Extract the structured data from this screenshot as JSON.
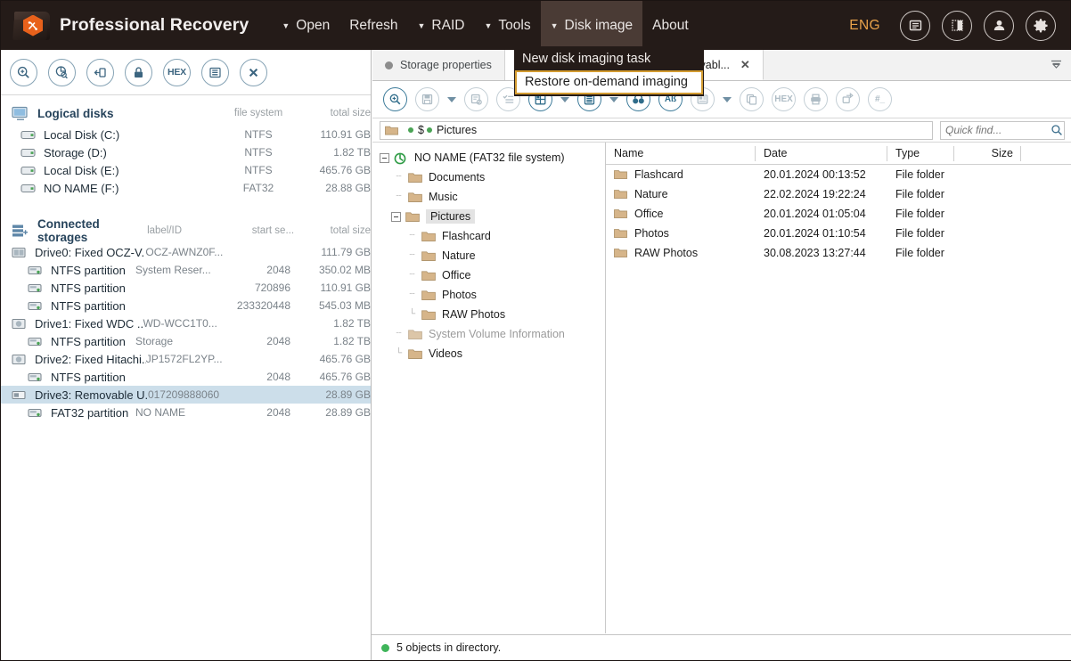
{
  "header": {
    "title": "Professional Recovery",
    "logo_icon": "app-folder-logo-icon",
    "menu": [
      {
        "label": "Open",
        "caret": "▼",
        "active": false
      },
      {
        "label": "Refresh",
        "caret": "",
        "active": false
      },
      {
        "label": "RAID",
        "caret": "▼",
        "active": false
      },
      {
        "label": "Tools",
        "caret": "▼",
        "active": false
      },
      {
        "label": "Disk image",
        "caret": "▼",
        "active": true
      },
      {
        "label": "About",
        "caret": "",
        "active": false
      }
    ],
    "language": "ENG",
    "round_buttons": [
      "notes-icon",
      "contrast-icon",
      "user-icon",
      "gear-icon"
    ]
  },
  "disk_image_menu": {
    "items": [
      {
        "label": "New disk imaging task",
        "selected": false
      },
      {
        "label": "Restore on-demand imaging",
        "selected": true
      }
    ],
    "highlight_color": "#d39b30"
  },
  "left_panel": {
    "toolbar": [
      "scan-icon",
      "partition-scan-icon",
      "open-image-icon",
      "unlock-icon",
      "hex-icon",
      "list-icon",
      "close-icon"
    ],
    "logical_disks": {
      "title": "Logical disks",
      "icon": "monitor-icon",
      "columns": [
        "file system",
        "total size"
      ],
      "rows": [
        {
          "icon": "drive-icon",
          "name": "Local Disk (C:)",
          "fs": "NTFS",
          "size": "110.91 GB"
        },
        {
          "icon": "drive-icon",
          "name": "Storage (D:)",
          "fs": "NTFS",
          "size": "1.82 TB"
        },
        {
          "icon": "drive-icon",
          "name": "Local Disk (E:)",
          "fs": "NTFS",
          "size": "465.76 GB"
        },
        {
          "icon": "drive-icon",
          "name": "NO NAME (F:)",
          "fs": "FAT32",
          "size": "28.88 GB"
        }
      ]
    },
    "connected_storages": {
      "title": "Connected storages",
      "icon": "stack-icon",
      "columns": [
        "label/ID",
        "start se...",
        "total size"
      ],
      "rows": [
        {
          "type": "storage",
          "icon": "ssd-icon",
          "name": "Drive0: Fixed OCZ-V...",
          "label": "OCZ-AWNZ0F...",
          "start": "",
          "size": "111.79 GB",
          "selected": false
        },
        {
          "type": "partition",
          "icon": "partition-icon",
          "name": "NTFS partition",
          "label": "System Reser...",
          "start": "2048",
          "size": "350.02 MB",
          "selected": false
        },
        {
          "type": "partition",
          "icon": "partition-icon",
          "name": "NTFS partition",
          "label": "",
          "start": "720896",
          "size": "110.91 GB",
          "selected": false
        },
        {
          "type": "partition",
          "icon": "partition-icon",
          "name": "NTFS partition",
          "label": "",
          "start": "233320448",
          "size": "545.03 MB",
          "selected": false
        },
        {
          "type": "storage",
          "icon": "hdd-icon",
          "name": "Drive1: Fixed WDC ...",
          "label": "WD-WCC1T0...",
          "start": "",
          "size": "1.82 TB",
          "selected": false
        },
        {
          "type": "partition",
          "icon": "partition-icon",
          "name": "NTFS partition",
          "label": "Storage",
          "start": "2048",
          "size": "1.82 TB",
          "selected": false
        },
        {
          "type": "storage",
          "icon": "hdd-icon",
          "name": "Drive2: Fixed Hitachi...",
          "label": "JP1572FL2YP...",
          "start": "",
          "size": "465.76 GB",
          "selected": false
        },
        {
          "type": "partition",
          "icon": "partition-icon",
          "name": "NTFS partition",
          "label": "",
          "start": "2048",
          "size": "465.76 GB",
          "selected": false
        },
        {
          "type": "storage",
          "icon": "usb-icon",
          "name": "Drive3: Removable U...",
          "label": "017209888060",
          "start": "",
          "size": "28.89 GB",
          "selected": true
        },
        {
          "type": "partition",
          "icon": "partition-icon",
          "name": "FAT32 partition",
          "label": "NO NAME",
          "start": "2048",
          "size": "28.89 GB",
          "selected": false
        }
      ]
    }
  },
  "right_panel": {
    "tabs": [
      {
        "label": "Storage properties",
        "active": false,
        "closable": false
      },
      {
        "label": "ME (FAT32 at 2048 on Drive3: Removabl...",
        "active": true,
        "closable": true
      }
    ],
    "tab_close_glyph": "✕",
    "tab_overflow_icon": "chevron-down-icon",
    "toolbar": [
      "scan-icon",
      "save-icon",
      "save-dropdown",
      "save-settings-icon",
      "checklist-icon",
      "layout-icon",
      "layout-dropdown",
      "view-icon",
      "view-dropdown",
      "find-icon",
      "case-icon",
      "preview-icon",
      "preview-dropdown",
      "copy-icon",
      "hex-icon",
      "print-icon",
      "export-icon",
      "numbers-icon"
    ],
    "path_bar": {
      "folder_icon": "folder-icon",
      "crumbs": [
        "$",
        "Pictures"
      ],
      "quick_find_placeholder": "Quick find...",
      "quick_find_value": "",
      "search_icon": "search-icon"
    },
    "tree": [
      {
        "depth": 0,
        "expander": "minus",
        "icon": "fat32-volume-icon",
        "label": "NO NAME (FAT32 file system)",
        "selected": false,
        "dim": false
      },
      {
        "depth": 1,
        "expander": "stub",
        "icon": "folder-icon",
        "label": "Documents",
        "selected": false,
        "dim": false
      },
      {
        "depth": 1,
        "expander": "stub",
        "icon": "folder-icon",
        "label": "Music",
        "selected": false,
        "dim": false
      },
      {
        "depth": 1,
        "expander": "minus",
        "icon": "folder-icon",
        "label": "Pictures",
        "selected": true,
        "dim": false
      },
      {
        "depth": 2,
        "expander": "stub",
        "icon": "folder-icon",
        "label": "Flashcard",
        "selected": false,
        "dim": false
      },
      {
        "depth": 2,
        "expander": "stub",
        "icon": "folder-icon",
        "label": "Nature",
        "selected": false,
        "dim": false
      },
      {
        "depth": 2,
        "expander": "stub",
        "icon": "folder-icon",
        "label": "Office",
        "selected": false,
        "dim": false
      },
      {
        "depth": 2,
        "expander": "stub",
        "icon": "folder-icon",
        "label": "Photos",
        "selected": false,
        "dim": false
      },
      {
        "depth": 2,
        "expander": "stub",
        "icon": "folder-icon",
        "label": "RAW Photos",
        "selected": false,
        "dim": false
      },
      {
        "depth": 1,
        "expander": "stub",
        "icon": "folder-icon",
        "label": "System Volume Information",
        "selected": false,
        "dim": true
      },
      {
        "depth": 1,
        "expander": "stub",
        "icon": "folder-icon",
        "label": "Videos",
        "selected": false,
        "dim": false
      }
    ],
    "file_list": {
      "columns": [
        "Name",
        "Date",
        "Type",
        "Size"
      ],
      "rows": [
        {
          "icon": "folder-icon",
          "name": "Flashcard",
          "date": "20.01.2024 00:13:52",
          "type": "File folder",
          "size": ""
        },
        {
          "icon": "folder-icon",
          "name": "Nature",
          "date": "22.02.2024 19:22:24",
          "type": "File folder",
          "size": ""
        },
        {
          "icon": "folder-icon",
          "name": "Office",
          "date": "20.01.2024 01:05:04",
          "type": "File folder",
          "size": ""
        },
        {
          "icon": "folder-icon",
          "name": "Photos",
          "date": "20.01.2024 01:10:54",
          "type": "File folder",
          "size": ""
        },
        {
          "icon": "folder-icon",
          "name": "RAW Photos",
          "date": "30.08.2023 13:27:44",
          "type": "File folder",
          "size": ""
        }
      ]
    },
    "status": {
      "text": "5 objects in directory.",
      "dot_color": "#3fb55a"
    }
  }
}
